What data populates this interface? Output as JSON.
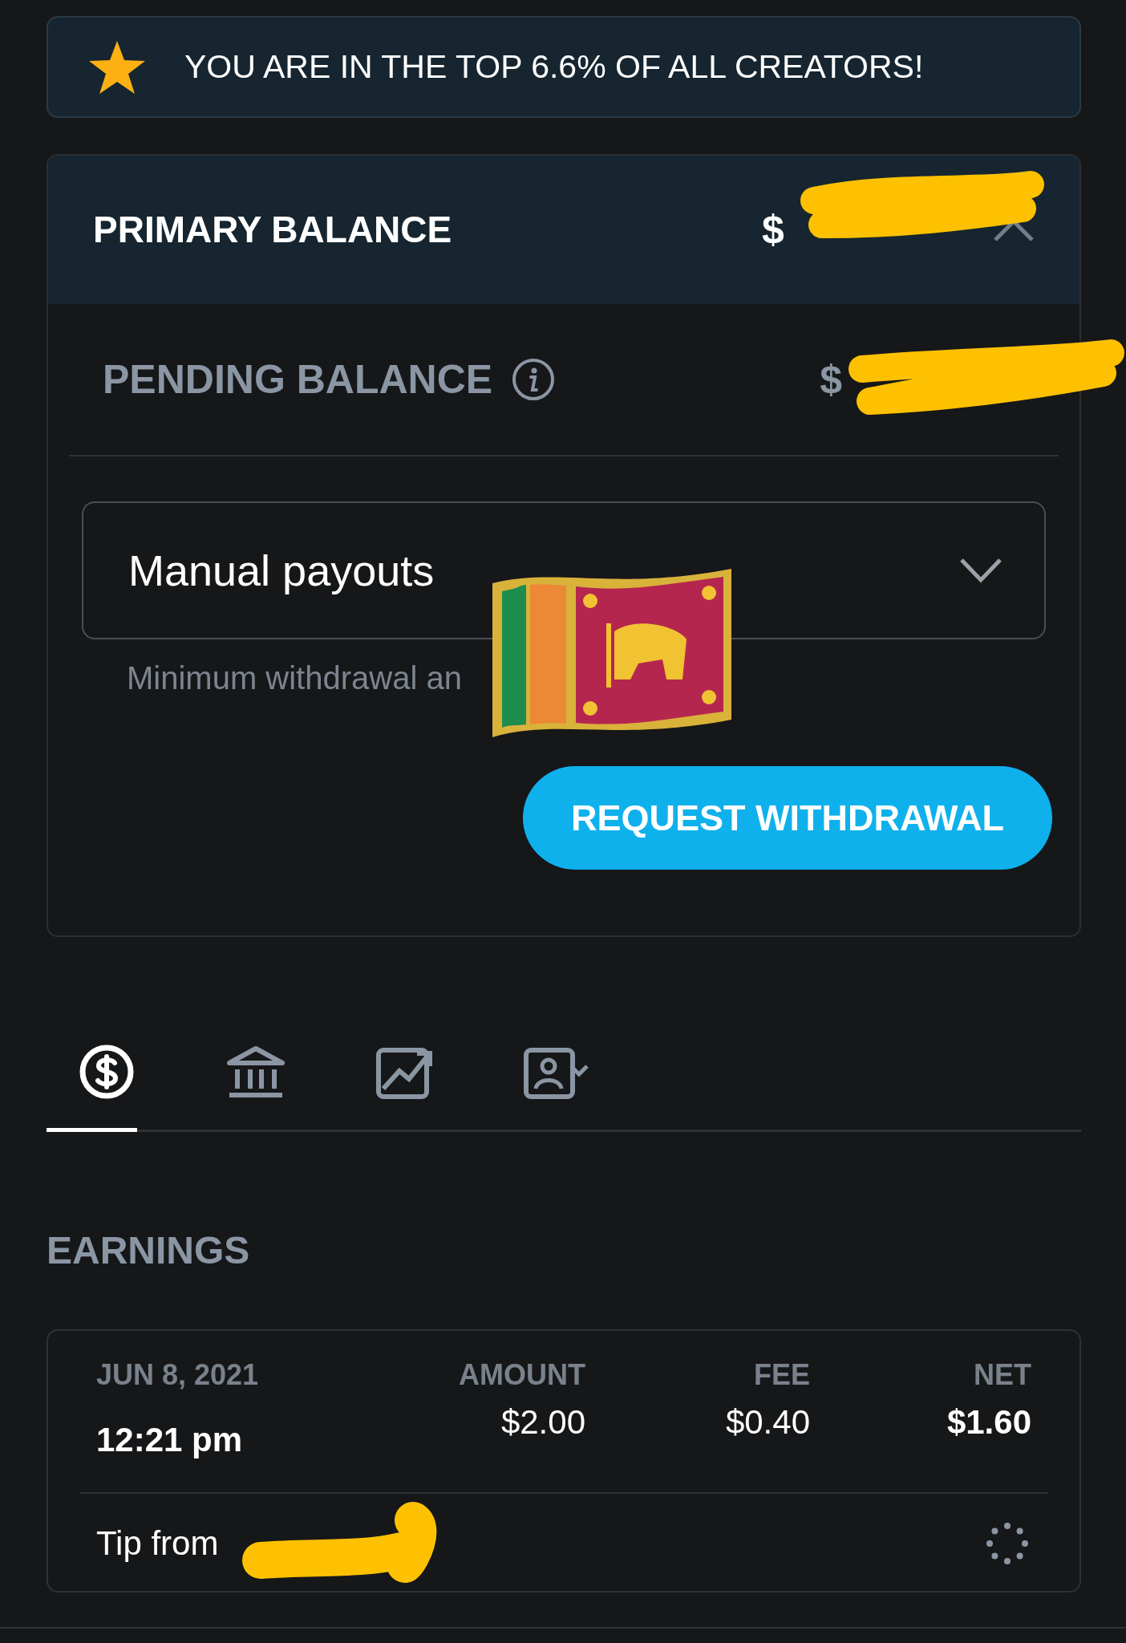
{
  "banner": {
    "text": "YOU ARE IN THE TOP 6.6% OF ALL CREATORS!"
  },
  "primary_balance": {
    "label": "PRIMARY BALANCE",
    "amount": "$",
    "expanded": true
  },
  "pending_balance": {
    "label": "PENDING BALANCE",
    "amount": "$"
  },
  "payout_select": {
    "value": "Manual payouts",
    "hint": "Minimum withdrawal an"
  },
  "withdraw_button": {
    "label": "REQUEST WITHDRAWAL"
  },
  "tabs": [
    {
      "kind": "dollar",
      "selected": true
    },
    {
      "kind": "bank",
      "selected": false
    },
    {
      "kind": "chart",
      "selected": false
    },
    {
      "kind": "profile",
      "selected": false
    }
  ],
  "earnings": {
    "title": "EARNINGS",
    "rows": [
      {
        "date": "JUN 8, 2021",
        "time": "12:21 pm",
        "amount_label": "AMOUNT",
        "amount": "$2.00",
        "fee_label": "FEE",
        "fee": "$0.40",
        "net_label": "NET",
        "net": "$1.60",
        "description": "Tip from"
      }
    ]
  }
}
